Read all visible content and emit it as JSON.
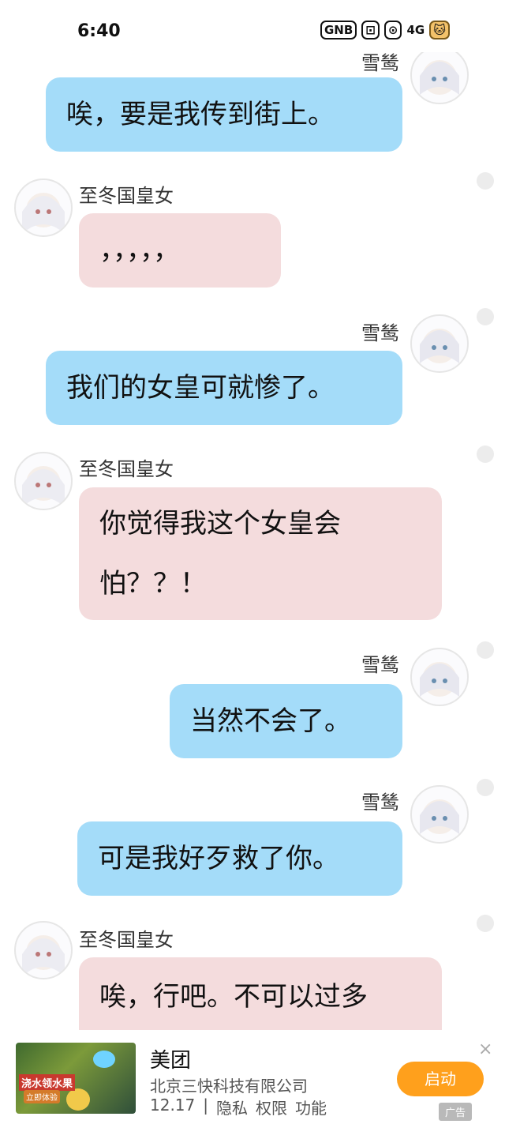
{
  "status_bar": {
    "time": "6:40",
    "icons": [
      "GNB",
      "⊡",
      "⊙",
      "4G",
      "🐱"
    ]
  },
  "messages": [
    {
      "sender": "雪鸶",
      "text": "唉，要是我传到街上。"
    },
    {
      "sender": "至冬国皇女",
      "text": "，，，，，"
    },
    {
      "sender": "雪鸶",
      "text": "我们的女皇可就惨了。"
    },
    {
      "sender": "至冬国皇女",
      "text": "你觉得我这个女皇会怕？？！"
    },
    {
      "sender": "雪鸶",
      "text": "当然不会了。"
    },
    {
      "sender": "雪鸶",
      "text": "可是我好歹救了你。"
    },
    {
      "sender": "至冬国皇女",
      "text": "唉，行吧。不可以过多"
    }
  ],
  "ad": {
    "thumb_title": "浇水领水果",
    "thumb_sub": "立即体验",
    "title": "美团",
    "company": "北京三快科技有限公司",
    "version": "12.17",
    "sep": "|",
    "links": [
      "隐私",
      "权限",
      "功能"
    ],
    "button": "启动",
    "close": "×",
    "badge": "广告"
  }
}
